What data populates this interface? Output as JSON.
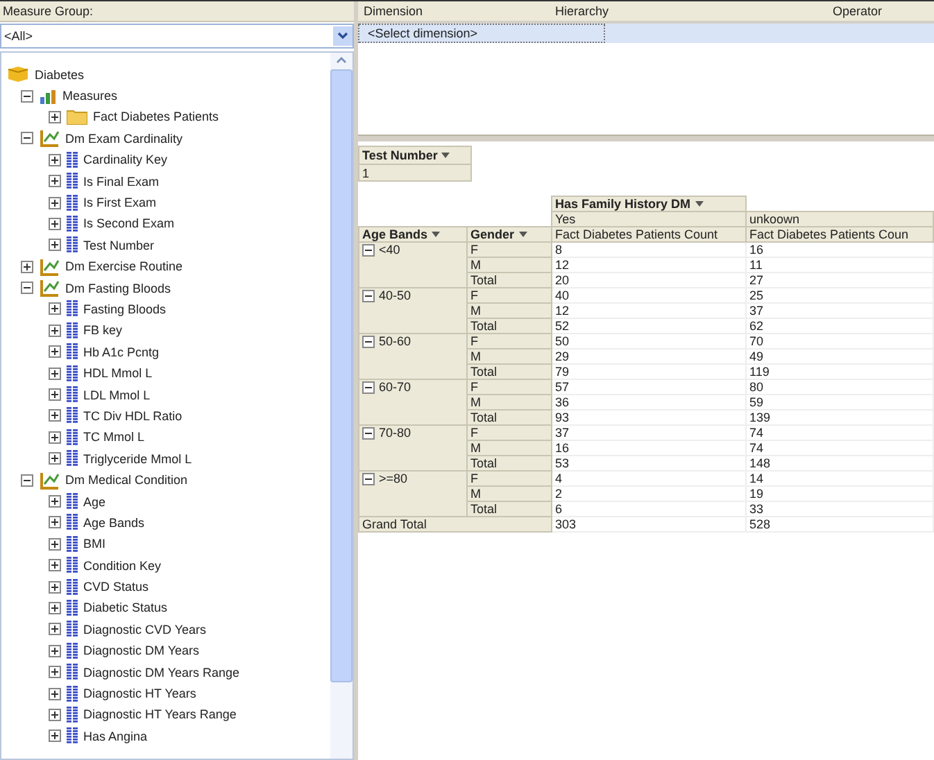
{
  "measure_group": {
    "label": "Measure Group:",
    "value": "<All>"
  },
  "tree": [
    {
      "label": "Diabetes",
      "kind": "cube",
      "children": [
        {
          "label": "Measures",
          "kind": "measures",
          "expanded": true,
          "children": [
            {
              "label": "Fact Diabetes Patients",
              "kind": "folder",
              "expanded": false
            }
          ]
        },
        {
          "label": "Dm Exam Cardinality",
          "kind": "dimension",
          "expanded": true,
          "children": [
            {
              "label": "Cardinality Key",
              "kind": "attribute",
              "expanded": false
            },
            {
              "label": "Is Final Exam",
              "kind": "attribute",
              "expanded": false
            },
            {
              "label": "Is First Exam",
              "kind": "attribute",
              "expanded": false
            },
            {
              "label": "Is Second Exam",
              "kind": "attribute",
              "expanded": false
            },
            {
              "label": "Test Number",
              "kind": "attribute",
              "expanded": false
            }
          ]
        },
        {
          "label": "Dm Exercise Routine",
          "kind": "dimension",
          "expanded": false
        },
        {
          "label": "Dm Fasting Bloods",
          "kind": "dimension",
          "expanded": true,
          "children": [
            {
              "label": "Fasting Bloods",
              "kind": "attribute",
              "expanded": false
            },
            {
              "label": "FB key",
              "kind": "attribute",
              "expanded": false
            },
            {
              "label": "Hb A1c Pcntg",
              "kind": "attribute",
              "expanded": false
            },
            {
              "label": "HDL Mmol L",
              "kind": "attribute",
              "expanded": false
            },
            {
              "label": "LDL Mmol L",
              "kind": "attribute",
              "expanded": false
            },
            {
              "label": "TC Div HDL Ratio",
              "kind": "attribute",
              "expanded": false
            },
            {
              "label": "TC Mmol L",
              "kind": "attribute",
              "expanded": false
            },
            {
              "label": "Triglyceride Mmol L",
              "kind": "attribute",
              "expanded": false
            }
          ]
        },
        {
          "label": "Dm Medical Condition",
          "kind": "dimension",
          "expanded": true,
          "children": [
            {
              "label": "Age",
              "kind": "attribute",
              "expanded": false
            },
            {
              "label": "Age Bands",
              "kind": "attribute",
              "expanded": false
            },
            {
              "label": "BMI",
              "kind": "attribute",
              "expanded": false
            },
            {
              "label": "Condition Key",
              "kind": "attribute",
              "expanded": false
            },
            {
              "label": "CVD Status",
              "kind": "attribute",
              "expanded": false
            },
            {
              "label": "Diabetic Status",
              "kind": "attribute",
              "expanded": false
            },
            {
              "label": "Diagnostic CVD Years",
              "kind": "attribute",
              "expanded": false
            },
            {
              "label": "Diagnostic DM Years",
              "kind": "attribute",
              "expanded": false
            },
            {
              "label": "Diagnostic DM Years Range",
              "kind": "attribute",
              "expanded": false
            },
            {
              "label": "Diagnostic HT Years",
              "kind": "attribute",
              "expanded": false
            },
            {
              "label": "Diagnostic HT Years Range",
              "kind": "attribute",
              "expanded": false
            },
            {
              "label": "Has Angina",
              "kind": "attribute",
              "expanded": false
            }
          ]
        }
      ]
    }
  ],
  "filter_grid": {
    "columns": [
      "Dimension",
      "Hierarchy",
      "Operator"
    ],
    "rows": [
      {
        "dimension": "<Select dimension>",
        "selected": true
      }
    ]
  },
  "pivot": {
    "filter_field": {
      "label": "Test Number",
      "value": "1"
    },
    "column_field": "Has Family History DM",
    "column_members": [
      "Yes",
      "unkoown"
    ],
    "row_fields": [
      "Age Bands",
      "Gender"
    ],
    "measure_headers": [
      "Fact Diabetes Patients Count",
      "Fact Diabetes Patients Coun"
    ],
    "groups": [
      {
        "label": "<40",
        "expanded": true,
        "rows": [
          {
            "label": "F",
            "values": [
              "8",
              "16"
            ]
          },
          {
            "label": "M",
            "values": [
              "12",
              "11"
            ]
          },
          {
            "label": "Total",
            "values": [
              "20",
              "27"
            ]
          }
        ]
      },
      {
        "label": "40-50",
        "expanded": true,
        "rows": [
          {
            "label": "F",
            "values": [
              "40",
              "25"
            ]
          },
          {
            "label": "M",
            "values": [
              "12",
              "37"
            ]
          },
          {
            "label": "Total",
            "values": [
              "52",
              "62"
            ]
          }
        ]
      },
      {
        "label": "50-60",
        "expanded": true,
        "rows": [
          {
            "label": "F",
            "values": [
              "50",
              "70"
            ]
          },
          {
            "label": "M",
            "values": [
              "29",
              "49"
            ]
          },
          {
            "label": "Total",
            "values": [
              "79",
              "119"
            ]
          }
        ]
      },
      {
        "label": "60-70",
        "expanded": true,
        "rows": [
          {
            "label": "F",
            "values": [
              "57",
              "80"
            ]
          },
          {
            "label": "M",
            "values": [
              "36",
              "59"
            ]
          },
          {
            "label": "Total",
            "values": [
              "93",
              "139"
            ]
          }
        ]
      },
      {
        "label": "70-80",
        "expanded": true,
        "rows": [
          {
            "label": "F",
            "values": [
              "37",
              "74"
            ]
          },
          {
            "label": "M",
            "values": [
              "16",
              "74"
            ]
          },
          {
            "label": "Total",
            "values": [
              "53",
              "148"
            ]
          }
        ]
      },
      {
        "label": ">=80",
        "expanded": true,
        "rows": [
          {
            "label": "F",
            "values": [
              "4",
              "14"
            ]
          },
          {
            "label": "M",
            "values": [
              "2",
              "19"
            ]
          },
          {
            "label": "Total",
            "values": [
              "6",
              "33"
            ]
          }
        ]
      }
    ],
    "grand_total": {
      "label": "Grand Total",
      "values": [
        "303",
        "528"
      ]
    }
  }
}
